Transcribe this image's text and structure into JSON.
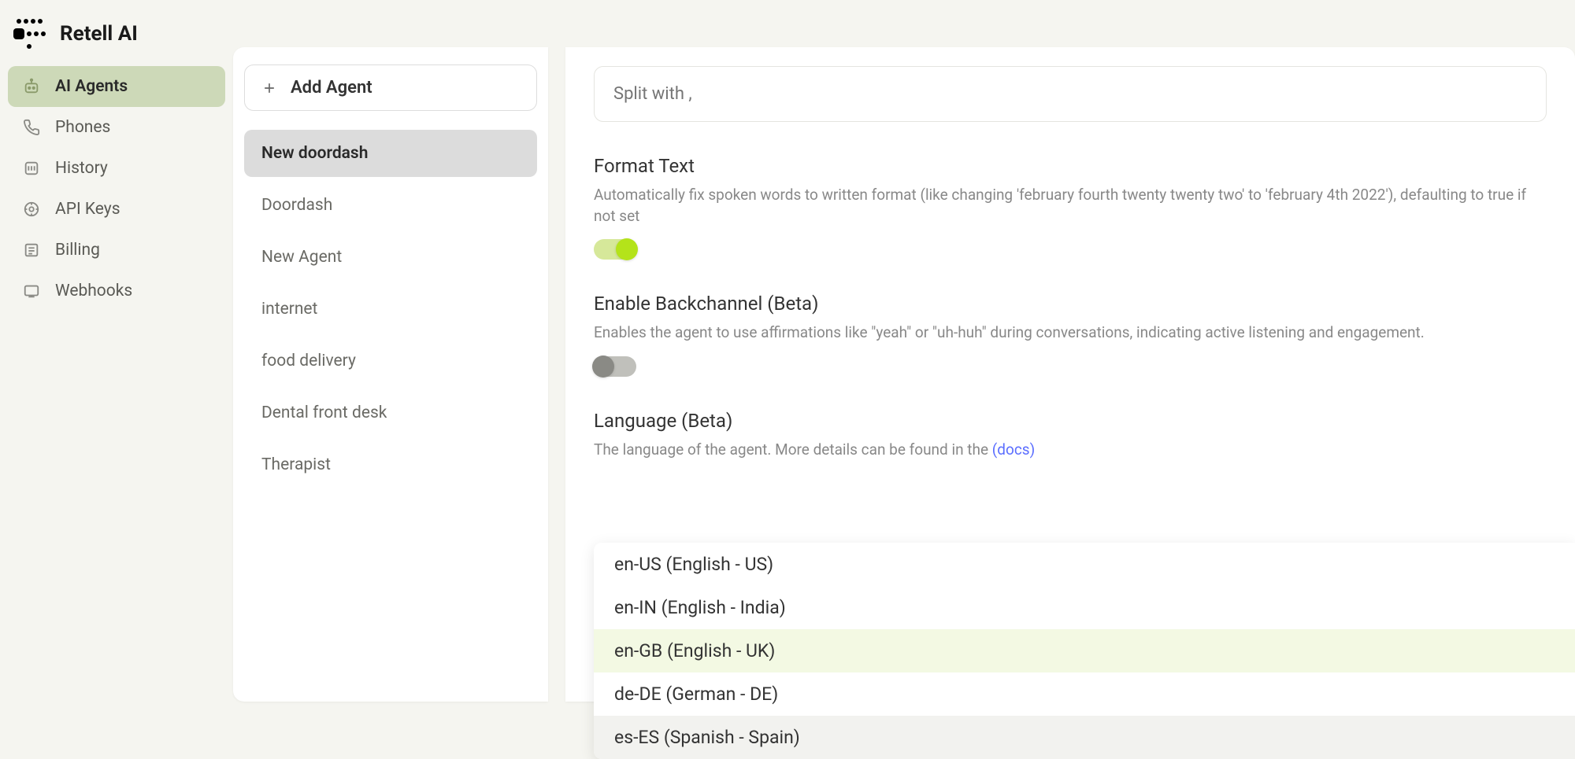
{
  "brand": "Retell AI",
  "sidebar": {
    "items": [
      {
        "label": "AI Agents",
        "icon": "robot-icon",
        "active": true
      },
      {
        "label": "Phones",
        "icon": "phone-icon",
        "active": false
      },
      {
        "label": "History",
        "icon": "history-icon",
        "active": false
      },
      {
        "label": "API Keys",
        "icon": "key-icon",
        "active": false
      },
      {
        "label": "Billing",
        "icon": "billing-icon",
        "active": false
      },
      {
        "label": "Webhooks",
        "icon": "webhook-icon",
        "active": false
      }
    ]
  },
  "agents_panel": {
    "add_label": "Add Agent",
    "items": [
      {
        "label": "New doordash",
        "selected": true
      },
      {
        "label": "Doordash",
        "selected": false
      },
      {
        "label": "New Agent",
        "selected": false
      },
      {
        "label": "internet",
        "selected": false
      },
      {
        "label": "food delivery",
        "selected": false
      },
      {
        "label": "Dental front desk",
        "selected": false
      },
      {
        "label": "Therapist",
        "selected": false
      }
    ]
  },
  "content": {
    "split_placeholder": "Split with ,",
    "format_text": {
      "title": "Format Text",
      "desc": "Automatically fix spoken words to written format (like changing 'february fourth twenty twenty two' to 'february 4th 2022'), defaulting to true if not set",
      "enabled": true
    },
    "backchannel": {
      "title": "Enable Backchannel (Beta)",
      "desc": "Enables the agent to use affirmations like \"yeah\" or \"uh-huh\" during conversations, indicating active listening and engagement.",
      "enabled": false
    },
    "language": {
      "title": "Language (Beta)",
      "desc_prefix": "The language of the agent. More details can be found in the ",
      "desc_link": "(docs)",
      "options": [
        {
          "label": "en-US (English - US)",
          "state": ""
        },
        {
          "label": "en-IN (English - India)",
          "state": ""
        },
        {
          "label": "en-GB (English - UK)",
          "state": "highlight"
        },
        {
          "label": "de-DE (German - DE)",
          "state": ""
        },
        {
          "label": "es-ES (Spanish - Spain)",
          "state": "hover"
        }
      ]
    }
  }
}
